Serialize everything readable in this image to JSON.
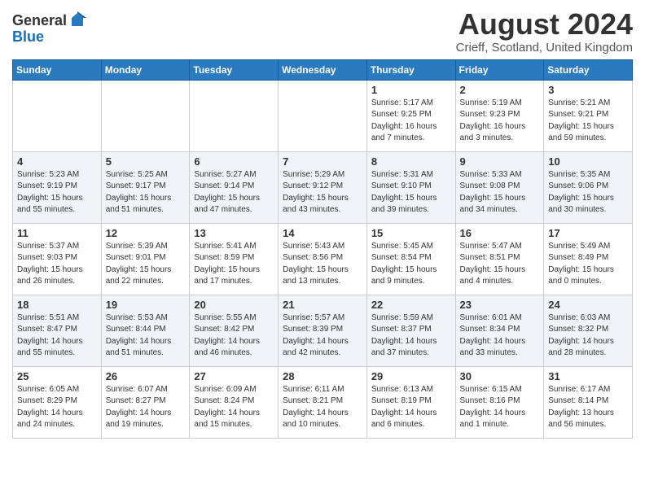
{
  "header": {
    "logo_general": "General",
    "logo_blue": "Blue",
    "month_title": "August 2024",
    "location": "Crieff, Scotland, United Kingdom"
  },
  "days_of_week": [
    "Sunday",
    "Monday",
    "Tuesday",
    "Wednesday",
    "Thursday",
    "Friday",
    "Saturday"
  ],
  "weeks": [
    [
      {
        "day": "",
        "detail": ""
      },
      {
        "day": "",
        "detail": ""
      },
      {
        "day": "",
        "detail": ""
      },
      {
        "day": "",
        "detail": ""
      },
      {
        "day": "1",
        "detail": "Sunrise: 5:17 AM\nSunset: 9:25 PM\nDaylight: 16 hours\nand 7 minutes."
      },
      {
        "day": "2",
        "detail": "Sunrise: 5:19 AM\nSunset: 9:23 PM\nDaylight: 16 hours\nand 3 minutes."
      },
      {
        "day": "3",
        "detail": "Sunrise: 5:21 AM\nSunset: 9:21 PM\nDaylight: 15 hours\nand 59 minutes."
      }
    ],
    [
      {
        "day": "4",
        "detail": "Sunrise: 5:23 AM\nSunset: 9:19 PM\nDaylight: 15 hours\nand 55 minutes."
      },
      {
        "day": "5",
        "detail": "Sunrise: 5:25 AM\nSunset: 9:17 PM\nDaylight: 15 hours\nand 51 minutes."
      },
      {
        "day": "6",
        "detail": "Sunrise: 5:27 AM\nSunset: 9:14 PM\nDaylight: 15 hours\nand 47 minutes."
      },
      {
        "day": "7",
        "detail": "Sunrise: 5:29 AM\nSunset: 9:12 PM\nDaylight: 15 hours\nand 43 minutes."
      },
      {
        "day": "8",
        "detail": "Sunrise: 5:31 AM\nSunset: 9:10 PM\nDaylight: 15 hours\nand 39 minutes."
      },
      {
        "day": "9",
        "detail": "Sunrise: 5:33 AM\nSunset: 9:08 PM\nDaylight: 15 hours\nand 34 minutes."
      },
      {
        "day": "10",
        "detail": "Sunrise: 5:35 AM\nSunset: 9:06 PM\nDaylight: 15 hours\nand 30 minutes."
      }
    ],
    [
      {
        "day": "11",
        "detail": "Sunrise: 5:37 AM\nSunset: 9:03 PM\nDaylight: 15 hours\nand 26 minutes."
      },
      {
        "day": "12",
        "detail": "Sunrise: 5:39 AM\nSunset: 9:01 PM\nDaylight: 15 hours\nand 22 minutes."
      },
      {
        "day": "13",
        "detail": "Sunrise: 5:41 AM\nSunset: 8:59 PM\nDaylight: 15 hours\nand 17 minutes."
      },
      {
        "day": "14",
        "detail": "Sunrise: 5:43 AM\nSunset: 8:56 PM\nDaylight: 15 hours\nand 13 minutes."
      },
      {
        "day": "15",
        "detail": "Sunrise: 5:45 AM\nSunset: 8:54 PM\nDaylight: 15 hours\nand 9 minutes."
      },
      {
        "day": "16",
        "detail": "Sunrise: 5:47 AM\nSunset: 8:51 PM\nDaylight: 15 hours\nand 4 minutes."
      },
      {
        "day": "17",
        "detail": "Sunrise: 5:49 AM\nSunset: 8:49 PM\nDaylight: 15 hours\nand 0 minutes."
      }
    ],
    [
      {
        "day": "18",
        "detail": "Sunrise: 5:51 AM\nSunset: 8:47 PM\nDaylight: 14 hours\nand 55 minutes."
      },
      {
        "day": "19",
        "detail": "Sunrise: 5:53 AM\nSunset: 8:44 PM\nDaylight: 14 hours\nand 51 minutes."
      },
      {
        "day": "20",
        "detail": "Sunrise: 5:55 AM\nSunset: 8:42 PM\nDaylight: 14 hours\nand 46 minutes."
      },
      {
        "day": "21",
        "detail": "Sunrise: 5:57 AM\nSunset: 8:39 PM\nDaylight: 14 hours\nand 42 minutes."
      },
      {
        "day": "22",
        "detail": "Sunrise: 5:59 AM\nSunset: 8:37 PM\nDaylight: 14 hours\nand 37 minutes."
      },
      {
        "day": "23",
        "detail": "Sunrise: 6:01 AM\nSunset: 8:34 PM\nDaylight: 14 hours\nand 33 minutes."
      },
      {
        "day": "24",
        "detail": "Sunrise: 6:03 AM\nSunset: 8:32 PM\nDaylight: 14 hours\nand 28 minutes."
      }
    ],
    [
      {
        "day": "25",
        "detail": "Sunrise: 6:05 AM\nSunset: 8:29 PM\nDaylight: 14 hours\nand 24 minutes."
      },
      {
        "day": "26",
        "detail": "Sunrise: 6:07 AM\nSunset: 8:27 PM\nDaylight: 14 hours\nand 19 minutes."
      },
      {
        "day": "27",
        "detail": "Sunrise: 6:09 AM\nSunset: 8:24 PM\nDaylight: 14 hours\nand 15 minutes."
      },
      {
        "day": "28",
        "detail": "Sunrise: 6:11 AM\nSunset: 8:21 PM\nDaylight: 14 hours\nand 10 minutes."
      },
      {
        "day": "29",
        "detail": "Sunrise: 6:13 AM\nSunset: 8:19 PM\nDaylight: 14 hours\nand 6 minutes."
      },
      {
        "day": "30",
        "detail": "Sunrise: 6:15 AM\nSunset: 8:16 PM\nDaylight: 14 hours\nand 1 minute."
      },
      {
        "day": "31",
        "detail": "Sunrise: 6:17 AM\nSunset: 8:14 PM\nDaylight: 13 hours\nand 56 minutes."
      }
    ]
  ]
}
